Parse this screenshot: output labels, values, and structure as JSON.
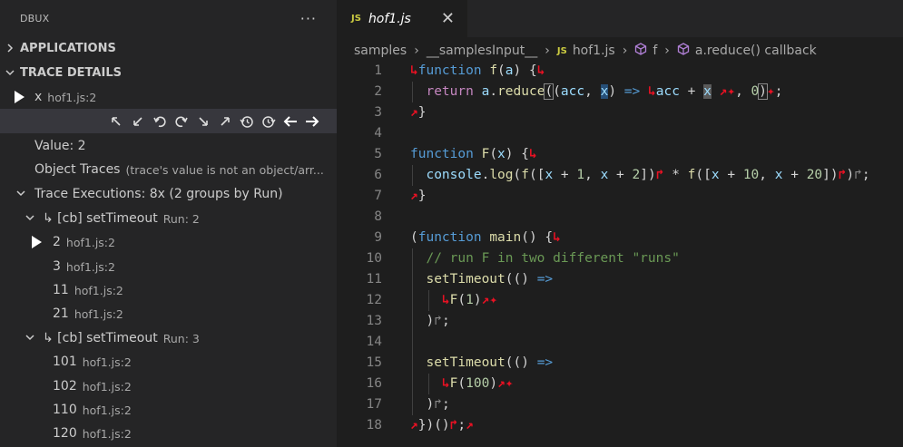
{
  "sidebar": {
    "title": "DBUX",
    "more": "···",
    "applications": "APPLICATIONS",
    "trace_details": "TRACE DETAILS",
    "trace": {
      "name": "x",
      "loc": "hof1.js:2"
    },
    "value": "Value: 2",
    "object_traces": {
      "label": "Object Traces",
      "note": "(trace's value is not an object/arr..."
    },
    "executions": "Trace Executions: 8x (2 groups by Run)",
    "groups": [
      {
        "label": "↳ [cb] setTimeout",
        "run": "Run: 2",
        "items": [
          {
            "v": "2",
            "loc": "hof1.js:2"
          },
          {
            "v": "3",
            "loc": "hof1.js:2"
          },
          {
            "v": "11",
            "loc": "hof1.js:2"
          },
          {
            "v": "21",
            "loc": "hof1.js:2"
          }
        ]
      },
      {
        "label": "↳ [cb] setTimeout",
        "run": "Run: 3",
        "items": [
          {
            "v": "101",
            "loc": "hof1.js:2"
          },
          {
            "v": "102",
            "loc": "hof1.js:2"
          },
          {
            "v": "110",
            "loc": "hof1.js:2"
          },
          {
            "v": "120",
            "loc": "hof1.js:2"
          }
        ]
      }
    ]
  },
  "editor": {
    "tab": {
      "icon": "JS",
      "name": "hof1.js",
      "close": "✕"
    },
    "breadcrumb": [
      "samples",
      "__samplesInput__",
      "hof1.js",
      "f",
      "a.reduce() callback"
    ],
    "line_numbers": [
      "1",
      "2",
      "3",
      "4",
      "5",
      "6",
      "7",
      "8",
      "9",
      "10",
      "11",
      "12",
      "13",
      "14",
      "15",
      "16",
      "17",
      "18"
    ]
  }
}
